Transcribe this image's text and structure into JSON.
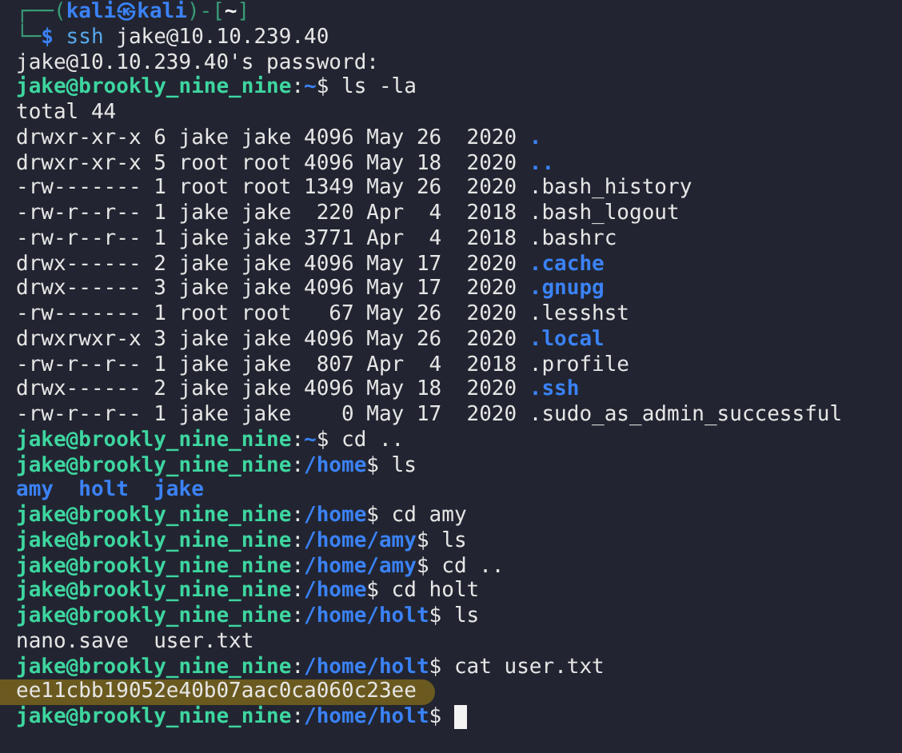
{
  "terminal": {
    "lines": [
      {
        "segments": [
          {
            "kind": "frame",
            "text": "┌──("
          },
          {
            "kind": "host",
            "text": "kali㉿kali"
          },
          {
            "kind": "frame",
            "text": ")-["
          },
          {
            "kind": "cwd",
            "text": "~"
          },
          {
            "kind": "frame",
            "text": "]"
          }
        ],
        "highlighted": false,
        "cursor": false
      },
      {
        "segments": [
          {
            "kind": "frame",
            "text": "└─"
          },
          {
            "kind": "host",
            "text": "$"
          },
          {
            "kind": "command",
            "text": " ssh"
          },
          {
            "kind": "plain",
            "text": " jake@10.10.239.40"
          }
        ],
        "highlighted": false,
        "cursor": false
      },
      {
        "segments": [
          {
            "kind": "plain",
            "text": "jake@10.10.239.40's password:"
          }
        ],
        "highlighted": false,
        "cursor": false
      },
      {
        "segments": [
          {
            "kind": "user",
            "text": "jake@brookly_nine_nine"
          },
          {
            "kind": "plain",
            "text": ":"
          },
          {
            "kind": "dir",
            "text": "~"
          },
          {
            "kind": "plain",
            "text": "$ ls -la"
          }
        ],
        "highlighted": false,
        "cursor": false
      },
      {
        "segments": [
          {
            "kind": "plain",
            "text": "total 44"
          }
        ],
        "highlighted": false,
        "cursor": false
      },
      {
        "segments": [
          {
            "kind": "plain",
            "text": "drwxr-xr-x 6 jake jake 4096 May 26  2020 "
          },
          {
            "kind": "dir",
            "text": "."
          }
        ],
        "highlighted": false,
        "cursor": false
      },
      {
        "segments": [
          {
            "kind": "plain",
            "text": "drwxr-xr-x 5 root root 4096 May 18  2020 "
          },
          {
            "kind": "dir",
            "text": ".."
          }
        ],
        "highlighted": false,
        "cursor": false
      },
      {
        "segments": [
          {
            "kind": "plain",
            "text": "-rw------- 1 root root 1349 May 26  2020 .bash_history"
          }
        ],
        "highlighted": false,
        "cursor": false
      },
      {
        "segments": [
          {
            "kind": "plain",
            "text": "-rw-r--r-- 1 jake jake  220 Apr  4  2018 .bash_logout"
          }
        ],
        "highlighted": false,
        "cursor": false
      },
      {
        "segments": [
          {
            "kind": "plain",
            "text": "-rw-r--r-- 1 jake jake 3771 Apr  4  2018 .bashrc"
          }
        ],
        "highlighted": false,
        "cursor": false
      },
      {
        "segments": [
          {
            "kind": "plain",
            "text": "drwx------ 2 jake jake 4096 May 17  2020 "
          },
          {
            "kind": "dir",
            "text": ".cache"
          }
        ],
        "highlighted": false,
        "cursor": false
      },
      {
        "segments": [
          {
            "kind": "plain",
            "text": "drwx------ 3 jake jake 4096 May 17  2020 "
          },
          {
            "kind": "dir",
            "text": ".gnupg"
          }
        ],
        "highlighted": false,
        "cursor": false
      },
      {
        "segments": [
          {
            "kind": "plain",
            "text": "-rw------- 1 root root   67 May 26  2020 .lesshst"
          }
        ],
        "highlighted": false,
        "cursor": false
      },
      {
        "segments": [
          {
            "kind": "plain",
            "text": "drwxrwxr-x 3 jake jake 4096 May 26  2020 "
          },
          {
            "kind": "dir",
            "text": ".local"
          }
        ],
        "highlighted": false,
        "cursor": false
      },
      {
        "segments": [
          {
            "kind": "plain",
            "text": "-rw-r--r-- 1 jake jake  807 Apr  4  2018 .profile"
          }
        ],
        "highlighted": false,
        "cursor": false
      },
      {
        "segments": [
          {
            "kind": "plain",
            "text": "drwx------ 2 jake jake 4096 May 18  2020 "
          },
          {
            "kind": "dir",
            "text": ".ssh"
          }
        ],
        "highlighted": false,
        "cursor": false
      },
      {
        "segments": [
          {
            "kind": "plain",
            "text": "-rw-r--r-- 1 jake jake    0 May 17  2020 .sudo_as_admin_successful"
          }
        ],
        "highlighted": false,
        "cursor": false
      },
      {
        "segments": [
          {
            "kind": "user",
            "text": "jake@brookly_nine_nine"
          },
          {
            "kind": "plain",
            "text": ":"
          },
          {
            "kind": "dir",
            "text": "~"
          },
          {
            "kind": "plain",
            "text": "$ cd .."
          }
        ],
        "highlighted": false,
        "cursor": false
      },
      {
        "segments": [
          {
            "kind": "user",
            "text": "jake@brookly_nine_nine"
          },
          {
            "kind": "plain",
            "text": ":"
          },
          {
            "kind": "dir",
            "text": "/home"
          },
          {
            "kind": "plain",
            "text": "$ ls"
          }
        ],
        "highlighted": false,
        "cursor": false
      },
      {
        "segments": [
          {
            "kind": "dir",
            "text": "amy  holt  jake"
          }
        ],
        "highlighted": false,
        "cursor": false
      },
      {
        "segments": [
          {
            "kind": "user",
            "text": "jake@brookly_nine_nine"
          },
          {
            "kind": "plain",
            "text": ":"
          },
          {
            "kind": "dir",
            "text": "/home"
          },
          {
            "kind": "plain",
            "text": "$ cd amy"
          }
        ],
        "highlighted": false,
        "cursor": false
      },
      {
        "segments": [
          {
            "kind": "user",
            "text": "jake@brookly_nine_nine"
          },
          {
            "kind": "plain",
            "text": ":"
          },
          {
            "kind": "dir",
            "text": "/home/amy"
          },
          {
            "kind": "plain",
            "text": "$ ls"
          }
        ],
        "highlighted": false,
        "cursor": false
      },
      {
        "segments": [
          {
            "kind": "user",
            "text": "jake@brookly_nine_nine"
          },
          {
            "kind": "plain",
            "text": ":"
          },
          {
            "kind": "dir",
            "text": "/home/amy"
          },
          {
            "kind": "plain",
            "text": "$ cd .."
          }
        ],
        "highlighted": false,
        "cursor": false
      },
      {
        "segments": [
          {
            "kind": "user",
            "text": "jake@brookly_nine_nine"
          },
          {
            "kind": "plain",
            "text": ":"
          },
          {
            "kind": "dir",
            "text": "/home"
          },
          {
            "kind": "plain",
            "text": "$ cd holt"
          }
        ],
        "highlighted": false,
        "cursor": false
      },
      {
        "segments": [
          {
            "kind": "user",
            "text": "jake@brookly_nine_nine"
          },
          {
            "kind": "plain",
            "text": ":"
          },
          {
            "kind": "dir",
            "text": "/home/holt"
          },
          {
            "kind": "plain",
            "text": "$ ls"
          }
        ],
        "highlighted": false,
        "cursor": false
      },
      {
        "segments": [
          {
            "kind": "plain",
            "text": "nano.save  user.txt"
          }
        ],
        "highlighted": false,
        "cursor": false
      },
      {
        "segments": [
          {
            "kind": "user",
            "text": "jake@brookly_nine_nine"
          },
          {
            "kind": "plain",
            "text": ":"
          },
          {
            "kind": "dir",
            "text": "/home/holt"
          },
          {
            "kind": "plain",
            "text": "$ cat user.txt"
          }
        ],
        "highlighted": false,
        "cursor": false
      },
      {
        "segments": [
          {
            "kind": "plain",
            "text": "ee11cbb19052e40b07aac0ca060c23ee"
          }
        ],
        "highlighted": true,
        "cursor": false
      },
      {
        "segments": [
          {
            "kind": "user",
            "text": "jake@brookly_nine_nine"
          },
          {
            "kind": "plain",
            "text": ":"
          },
          {
            "kind": "dir",
            "text": "/home/holt"
          },
          {
            "kind": "plain",
            "text": "$ "
          }
        ],
        "highlighted": false,
        "cursor": true
      }
    ]
  }
}
